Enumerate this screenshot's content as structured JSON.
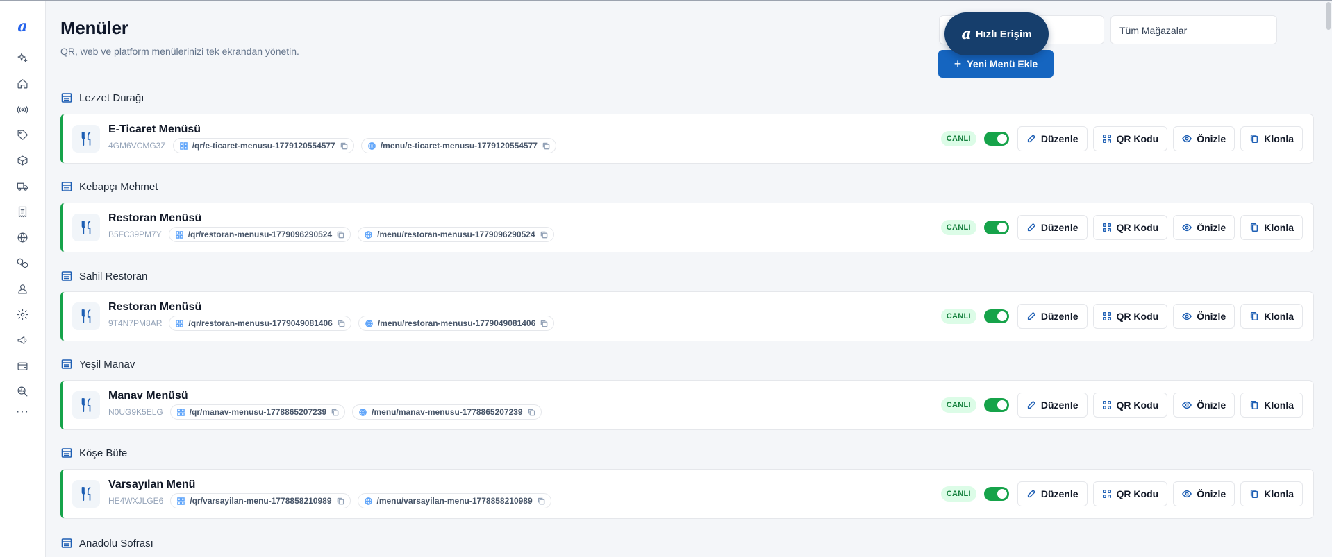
{
  "header": {
    "title": "Menüler",
    "subtitle": "QR, web ve platform menülerinizi tek ekrandan yönetin.",
    "quick_access_label": "Hızlı Erişim",
    "store_filter_value": "Tüm Mağazalar",
    "add_button_label": "Yeni Menü Ekle"
  },
  "sidebar": {
    "icons": [
      "sparkles-icon",
      "home-icon",
      "radio-icon",
      "tag-icon",
      "box-icon",
      "truck-icon",
      "receipt-icon",
      "globe-icon",
      "boxes-icon",
      "user-icon",
      "settings-icon",
      "megaphone-icon",
      "wallet-icon",
      "analytics-icon"
    ],
    "more_label": "···"
  },
  "actions": {
    "live_label": "CANLI",
    "edit_label": "Düzenle",
    "qr_label": "QR Kodu",
    "preview_label": "Önizle",
    "clone_label": "Klonla"
  },
  "groups": [
    {
      "store": "Lezzet Durağı",
      "menu_title": "E-Ticaret Menüsü",
      "code": "4GM6VCMG3Z",
      "qr_path": "/qr/e-ticaret-menusu-1779120554577",
      "web_path": "/menu/e-ticaret-menusu-1779120554577",
      "live": true
    },
    {
      "store": "Kebapçı Mehmet",
      "menu_title": "Restoran Menüsü",
      "code": "B5FC39PM7Y",
      "qr_path": "/qr/restoran-menusu-1779096290524",
      "web_path": "/menu/restoran-menusu-1779096290524",
      "live": true
    },
    {
      "store": "Sahil Restoran",
      "menu_title": "Restoran Menüsü",
      "code": "9T4N7PM8AR",
      "qr_path": "/qr/restoran-menusu-1779049081406",
      "web_path": "/menu/restoran-menusu-1779049081406",
      "live": true
    },
    {
      "store": "Yeşil Manav",
      "menu_title": "Manav Menüsü",
      "code": "N0UG9K5ELG",
      "qr_path": "/qr/manav-menusu-1778865207239",
      "web_path": "/menu/manav-menusu-1778865207239",
      "live": true
    },
    {
      "store": "Köşe Büfe",
      "menu_title": "Varsayılan Menü",
      "code": "HE4WXJLGE6",
      "qr_path": "/qr/varsayilan-menu-1778858210989",
      "web_path": "/menu/varsayilan-menu-1778858210989",
      "live": true
    },
    {
      "store": "Anadolu Sofrası"
    }
  ]
}
